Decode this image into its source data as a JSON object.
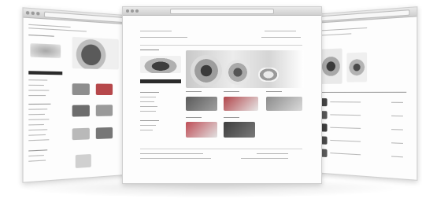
{
  "window_left": {
    "title": ""
  },
  "window_center": {
    "title": ""
  },
  "window_right": {
    "title": ""
  },
  "colors": {
    "accent": "#2b2b2b",
    "link": "#7a7a7a",
    "frame": "#cfcfcf"
  },
  "icons": [
    "car-thumbnail",
    "wheel-thumbnail",
    "accessory-thumbnail"
  ]
}
